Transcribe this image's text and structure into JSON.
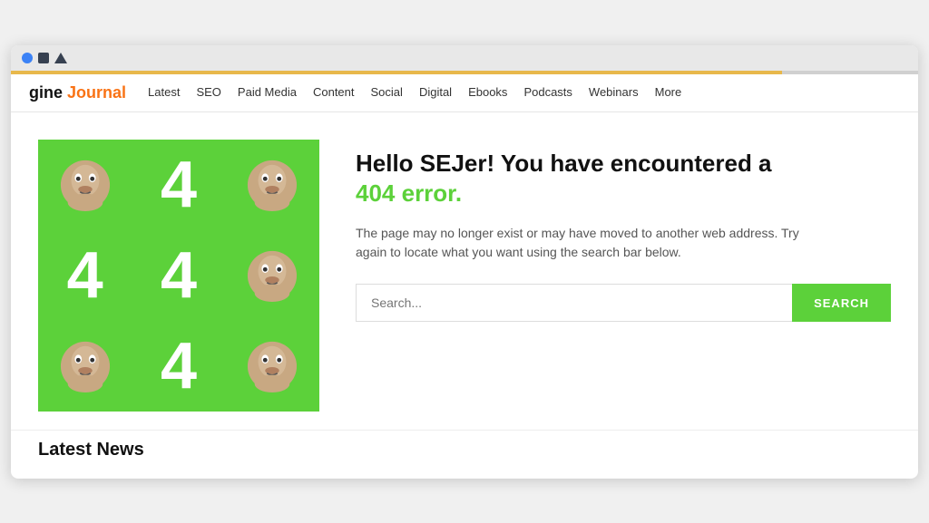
{
  "browser": {
    "loading_bar_width": "85%"
  },
  "nav": {
    "logo_prefix": "gine ",
    "logo_brand": "Journal",
    "items": [
      {
        "label": "Latest"
      },
      {
        "label": "SEO"
      },
      {
        "label": "Paid Media"
      },
      {
        "label": "Content"
      },
      {
        "label": "Social"
      },
      {
        "label": "Digital"
      },
      {
        "label": "Ebooks"
      },
      {
        "label": "Podcasts"
      },
      {
        "label": "Webinars"
      },
      {
        "label": "More"
      }
    ]
  },
  "error_page": {
    "heading_part1": "Hello SEJer! You have encountered a",
    "heading_part2": "404 error.",
    "description": "The page may no longer exist or may have moved to another web address. Try again to locate what you want using the search bar below.",
    "search_placeholder": "Search...",
    "search_button_label": "SEARCH"
  },
  "latest_news": {
    "heading": "Latest News"
  },
  "grid": {
    "cells": [
      {
        "type": "face"
      },
      {
        "type": "number",
        "value": "4"
      },
      {
        "type": "face"
      },
      {
        "type": "number",
        "value": "4"
      },
      {
        "type": "number",
        "value": "4"
      },
      {
        "type": "face"
      },
      {
        "type": "face"
      },
      {
        "type": "number",
        "value": "4"
      },
      {
        "type": "face"
      }
    ]
  }
}
